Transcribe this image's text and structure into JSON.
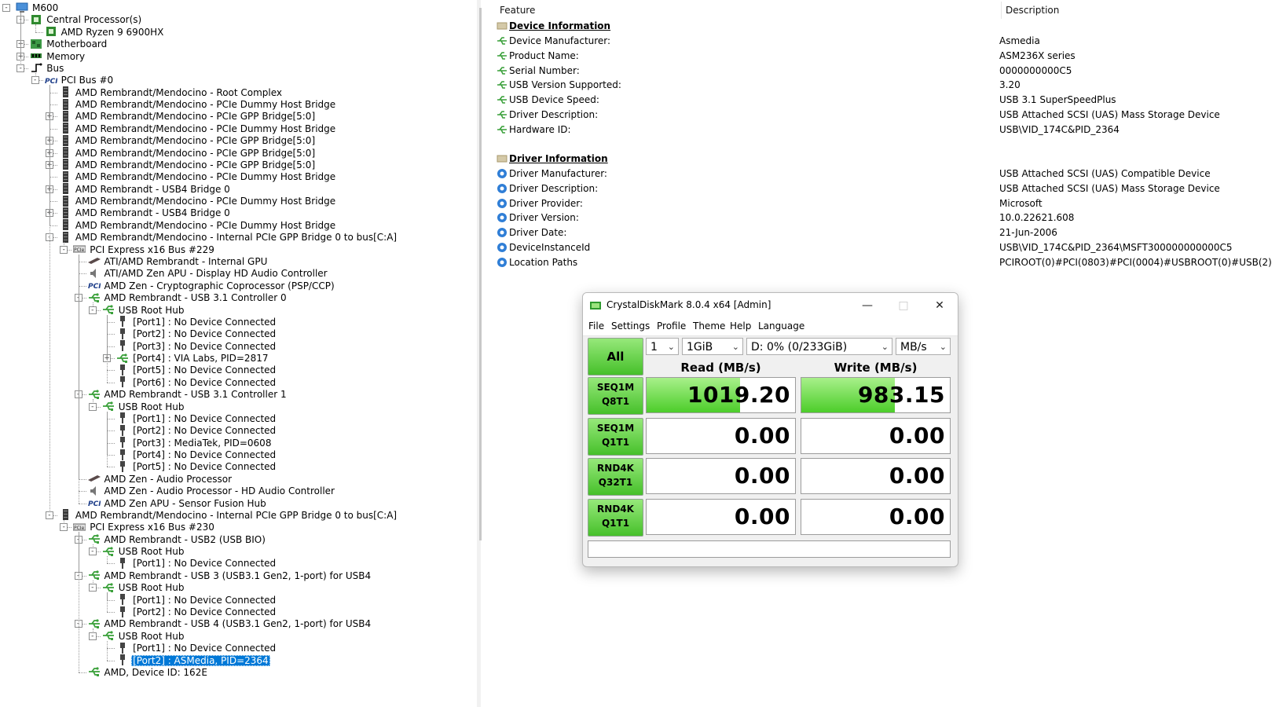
{
  "tree": {
    "nodes": [
      {
        "label": "M600",
        "icon": "computer-icon",
        "exp": "-"
      },
      {
        "label": "Central Processor(s)",
        "icon": "cpu-icon",
        "exp": "-"
      },
      {
        "label": "AMD Ryzen 9 6900HX",
        "icon": "cpu-icon",
        "exp": ""
      },
      {
        "label": "Motherboard",
        "icon": "motherboard-icon",
        "exp": "+"
      },
      {
        "label": "Memory",
        "icon": "memory-icon",
        "exp": "+"
      },
      {
        "label": "Bus",
        "icon": "bus-icon",
        "exp": "-"
      },
      {
        "label": "PCI Bus #0",
        "icon": "pci-icon",
        "exp": "-"
      },
      {
        "label": "AMD Rembrandt/Mendocino - Root Complex",
        "icon": "chip-icon",
        "exp": ""
      },
      {
        "label": "AMD Rembrandt/Mendocino - PCIe Dummy Host Bridge",
        "icon": "chip-icon",
        "exp": ""
      },
      {
        "label": "AMD Rembrandt/Mendocino - PCIe GPP Bridge[5:0]",
        "icon": "chip-icon",
        "exp": "+"
      },
      {
        "label": "AMD Rembrandt/Mendocino - PCIe Dummy Host Bridge",
        "icon": "chip-icon",
        "exp": ""
      },
      {
        "label": "AMD Rembrandt/Mendocino - PCIe GPP Bridge[5:0]",
        "icon": "chip-icon",
        "exp": "+"
      },
      {
        "label": "AMD Rembrandt/Mendocino - PCIe GPP Bridge[5:0]",
        "icon": "chip-icon",
        "exp": "+"
      },
      {
        "label": "AMD Rembrandt/Mendocino - PCIe GPP Bridge[5:0]",
        "icon": "chip-icon",
        "exp": "+"
      },
      {
        "label": "AMD Rembrandt/Mendocino - PCIe Dummy Host Bridge",
        "icon": "chip-icon",
        "exp": ""
      },
      {
        "label": "AMD Rembrandt - USB4 Bridge 0",
        "icon": "chip-icon",
        "exp": "+"
      },
      {
        "label": "AMD Rembrandt/Mendocino - PCIe Dummy Host Bridge",
        "icon": "chip-icon",
        "exp": ""
      },
      {
        "label": "AMD Rembrandt - USB4 Bridge 0",
        "icon": "chip-icon",
        "exp": "+"
      },
      {
        "label": "AMD Rembrandt/Mendocino - PCIe Dummy Host Bridge",
        "icon": "chip-icon",
        "exp": ""
      },
      {
        "label": "AMD Rembrandt/Mendocino - Internal PCIe GPP Bridge 0 to bus[C:A]",
        "icon": "chip-icon",
        "exp": "-"
      },
      {
        "label": "PCI Express x16 Bus #229",
        "icon": "pcie-icon",
        "exp": "-"
      },
      {
        "label": "ATI/AMD Rembrandt - Internal GPU",
        "icon": "gpu-icon",
        "exp": ""
      },
      {
        "label": "ATI/AMD Zen APU - Display HD Audio Controller",
        "icon": "speaker-icon",
        "exp": ""
      },
      {
        "label": "AMD Zen - Cryptographic Coprocessor (PSP/CCP)",
        "icon": "pci-icon",
        "exp": ""
      },
      {
        "label": "AMD Rembrandt - USB 3.1 Controller 0",
        "icon": "usb-icon",
        "exp": "-"
      },
      {
        "label": "USB Root Hub",
        "icon": "usb-icon",
        "exp": "-"
      },
      {
        "label": "[Port1] : No Device Connected",
        "icon": "usb-port-icon",
        "exp": ""
      },
      {
        "label": "[Port2] : No Device Connected",
        "icon": "usb-port-icon",
        "exp": ""
      },
      {
        "label": "[Port3] : No Device Connected",
        "icon": "usb-port-icon",
        "exp": ""
      },
      {
        "label": "[Port4] : VIA Labs, PID=2817",
        "icon": "usb-icon",
        "exp": "+"
      },
      {
        "label": "[Port5] : No Device Connected",
        "icon": "usb-port-icon",
        "exp": ""
      },
      {
        "label": "[Port6] : No Device Connected",
        "icon": "usb-port-icon",
        "exp": ""
      },
      {
        "label": "AMD Rembrandt - USB 3.1 Controller 1",
        "icon": "usb-icon",
        "exp": "-"
      },
      {
        "label": "USB Root Hub",
        "icon": "usb-icon",
        "exp": "-"
      },
      {
        "label": "[Port1] : No Device Connected",
        "icon": "usb-port-icon",
        "exp": ""
      },
      {
        "label": "[Port2] : No Device Connected",
        "icon": "usb-port-icon",
        "exp": ""
      },
      {
        "label": "[Port3] : MediaTek, PID=0608",
        "icon": "usb-port-icon",
        "exp": ""
      },
      {
        "label": "[Port4] : No Device Connected",
        "icon": "usb-port-icon",
        "exp": ""
      },
      {
        "label": "[Port5] : No Device Connected",
        "icon": "usb-port-icon",
        "exp": ""
      },
      {
        "label": "AMD Zen - Audio Processor",
        "icon": "gpu-icon",
        "exp": ""
      },
      {
        "label": "AMD Zen - Audio Processor - HD Audio Controller",
        "icon": "speaker-icon",
        "exp": ""
      },
      {
        "label": "AMD Zen APU - Sensor Fusion Hub",
        "icon": "pci-icon",
        "exp": ""
      },
      {
        "label": "AMD Rembrandt/Mendocino - Internal PCIe GPP Bridge 0 to bus[C:A]",
        "icon": "chip-icon",
        "exp": "-"
      },
      {
        "label": "PCI Express x16 Bus #230",
        "icon": "pcie-icon",
        "exp": "-"
      },
      {
        "label": "AMD Rembrandt - USB2 (USB BIO)",
        "icon": "usb-icon",
        "exp": "-"
      },
      {
        "label": "USB Root Hub",
        "icon": "usb-icon",
        "exp": "-"
      },
      {
        "label": "[Port1] : No Device Connected",
        "icon": "usb-port-icon",
        "exp": ""
      },
      {
        "label": "AMD Rembrandt - USB 3 (USB3.1 Gen2, 1-port) for USB4",
        "icon": "usb-icon",
        "exp": "-"
      },
      {
        "label": "USB Root Hub",
        "icon": "usb-icon",
        "exp": "-"
      },
      {
        "label": "[Port1] : No Device Connected",
        "icon": "usb-port-icon",
        "exp": ""
      },
      {
        "label": "[Port2] : No Device Connected",
        "icon": "usb-port-icon",
        "exp": ""
      },
      {
        "label": "AMD Rembrandt - USB 4 (USB3.1 Gen2, 1-port) for USB4",
        "icon": "usb-icon",
        "exp": "-"
      },
      {
        "label": "USB Root Hub",
        "icon": "usb-icon",
        "exp": "-"
      },
      {
        "label": "[Port1] : No Device Connected",
        "icon": "usb-port-icon",
        "exp": ""
      },
      {
        "label": "[Port2] : ASMedia, PID=2364",
        "icon": "usb-port-icon",
        "exp": "",
        "selected": true
      },
      {
        "label": "AMD, Device ID: 162E",
        "icon": "usb-icon",
        "exp": ""
      }
    ]
  },
  "details": {
    "col_feature": "Feature",
    "col_description": "Description",
    "device_section": "Device Information",
    "device_rows": [
      {
        "feature": "Device Manufacturer:",
        "value": "Asmedia"
      },
      {
        "feature": "Product Name:",
        "value": "ASM236X series"
      },
      {
        "feature": "Serial Number:",
        "value": "0000000000C5"
      },
      {
        "feature": "USB Version Supported:",
        "value": "3.20"
      },
      {
        "feature": "USB Device Speed:",
        "value": "USB 3.1 SuperSpeedPlus"
      },
      {
        "feature": "Driver Description:",
        "value": "USB Attached SCSI (UAS) Mass Storage Device"
      },
      {
        "feature": "Hardware ID:",
        "value": "USB\\VID_174C&PID_2364"
      }
    ],
    "driver_section": "Driver Information",
    "driver_rows": [
      {
        "feature": "Driver Manufacturer:",
        "value": "USB Attached SCSI (UAS) Compatible Device"
      },
      {
        "feature": "Driver Description:",
        "value": "USB Attached SCSI (UAS) Mass Storage Device"
      },
      {
        "feature": "Driver Provider:",
        "value": "Microsoft"
      },
      {
        "feature": "Driver Version:",
        "value": "10.0.22621.608"
      },
      {
        "feature": "Driver Date:",
        "value": "21-Jun-2006"
      },
      {
        "feature": "DeviceInstanceId",
        "value": "USB\\VID_174C&PID_2364\\MSFT300000000000C5"
      },
      {
        "feature": "Location Paths",
        "value": "PCIROOT(0)#PCI(0803)#PCI(0004)#USBROOT(0)#USB(2)"
      }
    ]
  },
  "cdm": {
    "title": "CrystalDiskMark 8.0.4 x64 [Admin]",
    "menu": [
      "File",
      "Settings",
      "Profile",
      "Theme",
      "Help",
      "Language"
    ],
    "all_label": "All",
    "count": "1",
    "size": "1GiB",
    "drive": "D: 0% (0/233GiB)",
    "unit": "MB/s",
    "read_header": "Read (MB/s)",
    "write_header": "Write (MB/s)",
    "tests": [
      {
        "line1": "SEQ1M",
        "line2": "Q8T1",
        "read": "1019.20",
        "write": "983.15",
        "read_fill": 0.63,
        "write_fill": 0.63
      },
      {
        "line1": "SEQ1M",
        "line2": "Q1T1",
        "read": "0.00",
        "write": "0.00",
        "read_fill": 0,
        "write_fill": 0
      },
      {
        "line1": "RND4K",
        "line2": "Q32T1",
        "read": "0.00",
        "write": "0.00",
        "read_fill": 0,
        "write_fill": 0
      },
      {
        "line1": "RND4K",
        "line2": "Q1T1",
        "read": "0.00",
        "write": "0.00",
        "read_fill": 0,
        "write_fill": 0
      }
    ],
    "status": ""
  },
  "colors": {
    "selection": "#0078d7",
    "usb_green": "#3aa03a",
    "cdm_green": "#46c02a"
  }
}
